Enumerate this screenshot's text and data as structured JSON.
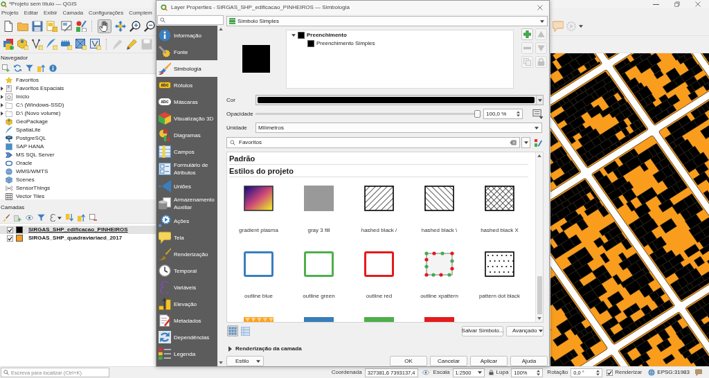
{
  "main_window": {
    "title": "*Projeto sem título — QGIS"
  },
  "menu": [
    "Projeto",
    "Editar",
    "Exibir",
    "Camada",
    "Configurações",
    "Complem"
  ],
  "toolbar_1": [
    {
      "selected": false
    },
    {
      "selected": false
    },
    {
      "selected": false
    },
    {
      "selected": false
    },
    {
      "selected": false
    },
    {
      "selected": false
    },
    {
      "selected": true
    },
    {
      "selected": false
    },
    {
      "selected": false
    },
    {
      "selected": false
    }
  ],
  "toolbar_1_right": [
    {
      "disabled": false
    },
    {
      "disabled": true
    }
  ],
  "toolbar_2": [
    {
      "disabled": false
    },
    {
      "disabled": false
    },
    {
      "disabled": false
    },
    {
      "disabled": false
    },
    {
      "disabled": false
    },
    {
      "disabled": false
    },
    {
      "disabled": false
    },
    {
      "disabled": true
    },
    {
      "disabled": false
    },
    {
      "disabled": true
    }
  ],
  "navigator": {
    "title": "Navegador",
    "items": [
      {
        "label": "Favoritos",
        "expandable": false
      },
      {
        "label": "Favoritos Espaciais",
        "expandable": true
      },
      {
        "label": "Início",
        "expandable": true
      },
      {
        "label": "C:\\ (Windows-SSD)",
        "expandable": true
      },
      {
        "label": "D:\\ (Novo volume)",
        "expandable": true
      },
      {
        "label": "GeoPackage",
        "expandable": false
      },
      {
        "label": "SpatiaLite",
        "expandable": false
      },
      {
        "label": "PostgreSQL",
        "expandable": false
      },
      {
        "label": "SAP HANA",
        "expandable": false
      },
      {
        "label": "MS SQL Server",
        "expandable": false
      },
      {
        "label": "Oracle",
        "expandable": false
      },
      {
        "label": "WMS/WMTS",
        "expandable": false
      },
      {
        "label": "Scenes",
        "expandable": false
      },
      {
        "label": "SensorThings",
        "expandable": false
      },
      {
        "label": "Vector Tiles",
        "expandable": false
      }
    ]
  },
  "layers_panel": {
    "title": "Camadas",
    "layers": [
      {
        "name": "SIRGAS_SHP_edificacao_PINHEIROS",
        "checked": true,
        "color": "#000000",
        "selected": true
      },
      {
        "name": "SIRGAS_SHP_quadraviariaed_2017",
        "checked": true,
        "color": "#fa9d1c",
        "selected": false
      }
    ]
  },
  "locator": {
    "placeholder": "Escreva para localizar (Ctrl+K)"
  },
  "dialog": {
    "title": "Layer Properties - SIRGAS_SHP_edificacao_PINHEIROS — Simbologia",
    "sidebar": [
      {
        "label": "Informação",
        "selected": false
      },
      {
        "label": "Fonte",
        "selected": false
      },
      {
        "label": "Simbologia",
        "selected": true
      },
      {
        "label": "Rótulos",
        "selected": false,
        "badge": {
          "text": "abc",
          "kind": "tag"
        }
      },
      {
        "label": "Máscaras",
        "selected": false,
        "badge": {
          "text": "abc",
          "kind": "outline"
        }
      },
      {
        "label": "Visualização 3D",
        "selected": false
      },
      {
        "label": "Diagramas",
        "selected": false
      },
      {
        "label": "Campos",
        "selected": false
      },
      {
        "label": "Formulário de Atributos",
        "selected": false
      },
      {
        "label": "Uniões",
        "selected": false
      },
      {
        "label": "Armazenamento Auxiliar",
        "selected": false
      },
      {
        "label": "Ações",
        "selected": false
      },
      {
        "label": "Tela",
        "selected": false
      },
      {
        "label": "Renderização",
        "selected": false
      },
      {
        "label": "Temporal",
        "selected": false
      },
      {
        "label": "Variáveis",
        "selected": false
      },
      {
        "label": "Elevação",
        "selected": false
      },
      {
        "label": "Metadados",
        "selected": false
      },
      {
        "label": "Dependências",
        "selected": false
      },
      {
        "label": "Legenda",
        "selected": false
      }
    ],
    "renderer": "Símbolo Simples",
    "symbol_layers": {
      "label": "Preenchimento",
      "expanded": true,
      "children": [
        {
          "label": "Preenchimento Simples"
        }
      ]
    },
    "layer_buttons": [
      {
        "disabled": false
      },
      {
        "disabled": true
      },
      {
        "disabled": true
      },
      {
        "disabled": true
      },
      {
        "disabled": true
      },
      {
        "disabled": true
      }
    ],
    "color_field": {
      "label": "Cor",
      "color": "#000000"
    },
    "opacity": {
      "label": "Opacidade",
      "level": 1,
      "reading": "100,0 %"
    },
    "unit": {
      "label": "Unidade",
      "value": "Milímetros"
    },
    "symbol_search": {
      "value": "Favoritos"
    },
    "symbol_groups": [
      "Padrão",
      "Estilos do projeto"
    ],
    "symbols": [
      {
        "label": "gradient plasma",
        "kind": "gradient"
      },
      {
        "label": "gray 3 fill",
        "kind": "fill",
        "color": "#999999"
      },
      {
        "label": "hashed black /",
        "kind": "slash"
      },
      {
        "label": "hashed black \\",
        "kind": "backslash"
      },
      {
        "label": "hashed black X",
        "kind": "crosshatch"
      },
      {
        "label": "outline blue",
        "kind": "outline",
        "color": "#3a7ebf"
      },
      {
        "label": "outline green",
        "kind": "outline",
        "color": "#4daf4a"
      },
      {
        "label": "outline red",
        "kind": "outline",
        "color": "#e41a1c"
      },
      {
        "label": "outline xpattern",
        "kind": "markers"
      },
      {
        "label": "pattern dot black",
        "kind": "dots"
      },
      {
        "kind": "zigzag",
        "color": "#ff9f1c"
      },
      {
        "kind": "fill",
        "color": "#377eb8"
      },
      {
        "kind": "fill",
        "color": "#4daf4a"
      },
      {
        "kind": "fill",
        "color": "#e41a1c"
      }
    ],
    "view_modes": [
      {
        "selected": true
      },
      {
        "selected": false
      }
    ],
    "save_button": "Salvar Símbolo...",
    "advanced_button": "Avançado",
    "layer_rendering": {
      "label": "Renderização da camada",
      "expanded": false
    },
    "style_button": "Estilo",
    "buttons": [
      "OK",
      "Cancelar",
      "Aplicar",
      "Ajuda"
    ]
  },
  "status_bar": {
    "coordinate_label": "Coordenada",
    "coordinate": "327381,6 7393137,4",
    "scale_label": "Escala",
    "scale": "1:2500",
    "magnifier_label": "Lupa",
    "magnifier": "100%",
    "rotation_label": "Rotação",
    "rotation": "0,0 °",
    "render": {
      "label": "Renderizar",
      "checked": true
    },
    "crs": "EPSG:31983"
  }
}
